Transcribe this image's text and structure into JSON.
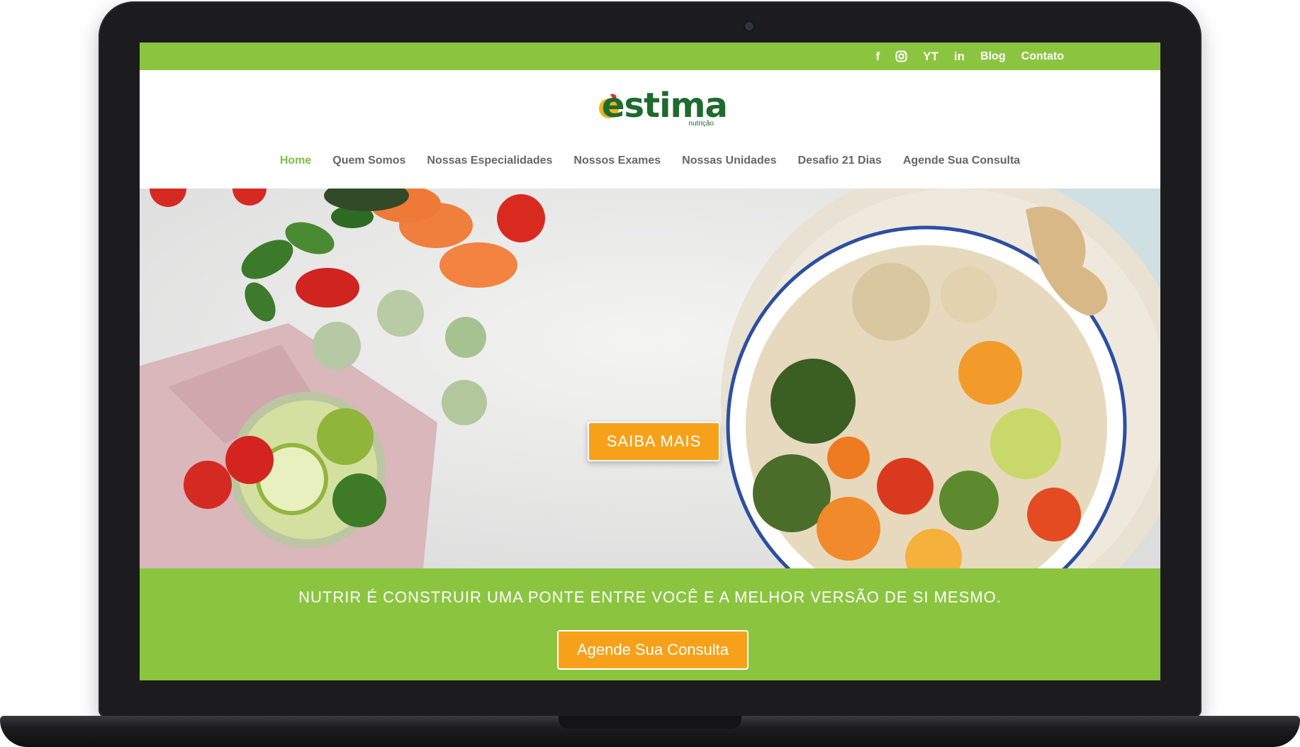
{
  "topbar": {
    "social": [
      {
        "icon": "facebook-icon",
        "label": "f"
      },
      {
        "icon": "instagram-icon",
        "label": ""
      },
      {
        "icon": "youtube-icon",
        "label": "YT"
      },
      {
        "icon": "linkedin-icon",
        "label": "in"
      }
    ],
    "links": [
      "Blog",
      "Contato"
    ]
  },
  "logo": {
    "text": "estima",
    "sub": "nutrição"
  },
  "nav": {
    "items": [
      {
        "label": "Home",
        "active": true
      },
      {
        "label": "Quem Somos"
      },
      {
        "label": "Nossas Especialidades"
      },
      {
        "label": "Nossos Exames"
      },
      {
        "label": "Nossas Unidades"
      },
      {
        "label": "Desafio 21 Dias"
      },
      {
        "label": "Agende Sua Consulta"
      }
    ]
  },
  "hero": {
    "button": "SAIBA MAIS"
  },
  "band": {
    "tagline": "NUTRIR É CONSTRUIR UMA PONTE ENTRE VOCÊ E A MELHOR VERSÃO DE SI MESMO.",
    "button": "Agende Sua Consulta"
  },
  "colors": {
    "green": "#8bc540",
    "orange": "#f7a11a",
    "active_nav": "#7cc042",
    "logo_green": "#1f6a2e"
  }
}
